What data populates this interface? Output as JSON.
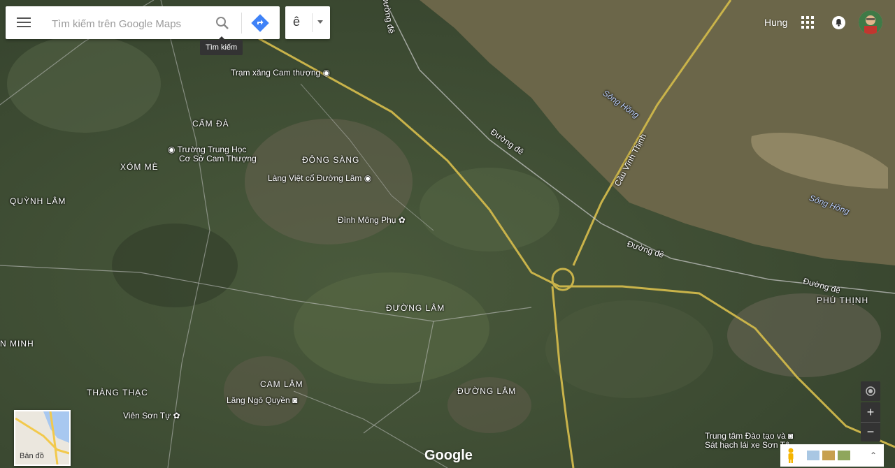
{
  "search": {
    "placeholder": "Tìm kiếm trên Google Maps",
    "tooltip": "Tìm kiếm"
  },
  "language": {
    "label": "ê"
  },
  "user": {
    "name": "Hung"
  },
  "minimap": {
    "label": "Bản đồ"
  },
  "brand": {
    "logo_text": "Google"
  },
  "controls": {
    "zoom_in": "+",
    "zoom_out": "−",
    "expand": "⌃"
  },
  "map": {
    "labels": {
      "cam_da": "CẨM ĐÀ",
      "xom_me": "XÓM MÈ",
      "quynh_lam": "QUỲNH LÂM",
      "dong_sang": "ĐÔNG SÀNG",
      "duong_lam_1": "ĐƯỜNG LÂM",
      "duong_lam_2": "ĐƯỜNG LÂM",
      "cam_lam": "CAM LÂM",
      "thang_thac": "THÀNG THẠC",
      "an_minh": "N MINH",
      "phu_thinh": "PHÚ THỊNH",
      "tram_xang": "Trạm xăng Cam thượng",
      "truong_1": "Trường Trung Học",
      "truong_2": "Cơ Sở Cam Thượng",
      "lang_viet_co": "Làng Việt cổ Đường Lâm",
      "dinh_mong_phu": "Đình Mông Phụ",
      "lang_ngo_quyen": "Lăng Ngô Quyền",
      "vien_son_tu": "Viên Sơn Tự",
      "song_hong_1": "Sông Hồng",
      "song_hong_2": "Sông Hồng",
      "cau_vinh_thinh": "Cầu Vĩnh Thịnh",
      "duong_de_1": "Đường đê",
      "duong_de_2": "Đường đê",
      "duong_de_3": "Đường đê",
      "duong_de_top": "Đường đê",
      "trung_tam_1": "Trung tâm Đào tạo và",
      "trung_tam_2": "Sát hạch lái xe Sơn Tâ"
    }
  },
  "colors": {
    "river": "#6b6649",
    "terrain": "#3f4d34",
    "road": "#c9b34a"
  }
}
